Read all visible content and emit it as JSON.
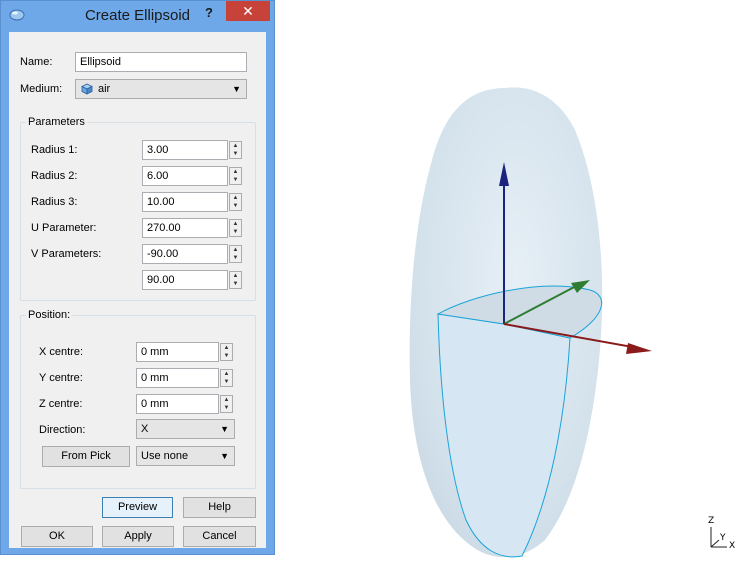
{
  "dialog": {
    "title": "Create Ellipsoid",
    "help_glyph": "?",
    "close_glyph": "✕",
    "name_label": "Name:",
    "name_value": "Ellipsoid",
    "medium_label": "Medium:",
    "medium_value": "air",
    "parameters": {
      "title": "Parameters",
      "radius1_label": "Radius 1:",
      "radius1_value": "3.00",
      "radius2_label": "Radius 2:",
      "radius2_value": "6.00",
      "radius3_label": "Radius 3:",
      "radius3_value": "10.00",
      "u_label": "U Parameter:",
      "u_value": "270.00",
      "v_label": "V Parameters:",
      "v_value_1": "-90.00",
      "v_value_2": "90.00"
    },
    "position": {
      "title": "Position:",
      "x_label": "X centre:",
      "x_value": "0 mm",
      "y_label": "Y centre:",
      "y_value": "0 mm",
      "z_label": "Z centre:",
      "z_value": "0 mm",
      "direction_label": "Direction:",
      "direction_value": "X",
      "from_pick_label": "From Pick",
      "use_none_value": "Use none"
    },
    "buttons": {
      "preview": "Preview",
      "help": "Help",
      "ok": "OK",
      "apply": "Apply",
      "cancel": "Cancel"
    }
  },
  "viewport": {
    "triad": {
      "z": "Z",
      "y": "Y",
      "x": "X"
    },
    "colors": {
      "x_axis": "#8b1a1a",
      "y_axis": "#2e7d32",
      "z_axis": "#1a237e",
      "ellipsoid": "#dce9f2",
      "edge": "#1aa3d9"
    }
  }
}
